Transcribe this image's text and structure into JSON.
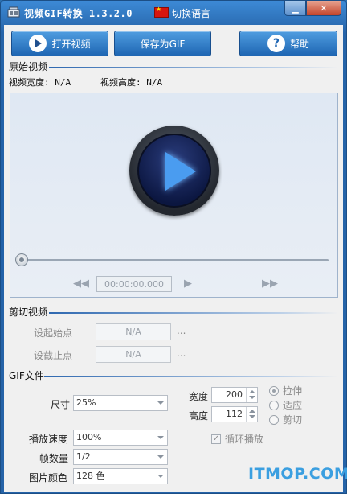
{
  "window": {
    "title": "视频GIF转换 1.3.2.0",
    "lang_link": "切换语言"
  },
  "toolbar": {
    "open_video": "打开视频",
    "save_gif": "保存为GIF",
    "help": "帮助",
    "help_icon_glyph": "?"
  },
  "original_video": {
    "section_title": "原始视频",
    "width_label": "视频宽度: N/A",
    "height_label": "视频高度: N/A",
    "time": "00:00:00.000",
    "progress": 0
  },
  "trim": {
    "section_title": "剪切视频",
    "start_label": "设起始点",
    "start_value": "N/A",
    "end_label": "设截止点",
    "end_value": "N/A",
    "dots": "..."
  },
  "gif": {
    "section_title": "GIF文件",
    "size_label": "尺寸",
    "size_value": "25%",
    "width_label": "宽度",
    "width_value": "200",
    "height_label": "高度",
    "height_value": "112",
    "mode_stretch": "拉伸",
    "mode_fit": "适应",
    "mode_crop": "剪切",
    "speed_label": "播放速度",
    "speed_value": "100%",
    "frames_label": "帧数量",
    "frames_value": "1/2",
    "colors_label": "图片颜色",
    "colors_value": "128 色",
    "loop_label": "循环播放",
    "loop_checked": true
  },
  "watermark": "ITMOP.COM",
  "colors": {
    "titlebar": "#2563a8",
    "button_blue": "#1f66b3",
    "watermark": "#3b9fe0"
  }
}
